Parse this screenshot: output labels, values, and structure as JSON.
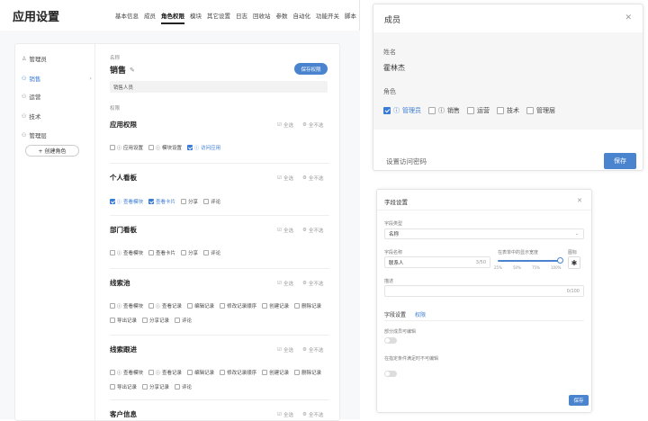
{
  "app": {
    "title": "应用设置",
    "tabs": [
      "基本信息",
      "成员",
      "角色权限",
      "模块",
      "其它设置",
      "日志",
      "回收站",
      "参数",
      "自动化",
      "功能开关",
      "脚本"
    ],
    "active_tab": "角色权限"
  },
  "sidebar": {
    "items": [
      {
        "label": "管理员",
        "icon": "user-icon"
      },
      {
        "label": "销售",
        "icon": "users-icon",
        "active": true
      },
      {
        "label": "运营",
        "icon": "users-icon"
      },
      {
        "label": "技术",
        "icon": "users-icon"
      },
      {
        "label": "管理层",
        "icon": "users-icon"
      }
    ],
    "create_label": "+ 创建角色"
  },
  "role": {
    "name_label": "名称",
    "name": "销售",
    "desc": "销售人员",
    "save_label": "保存权限",
    "perm_label": "权限"
  },
  "common": {
    "select_all": "全选",
    "select_none": "全不选"
  },
  "sections": [
    {
      "title": "应用权限",
      "options": [
        {
          "label": "应用设置",
          "info": true
        },
        {
          "label": "模块设置",
          "info": true
        },
        {
          "label": "访问应用",
          "info": true,
          "checked": true
        }
      ]
    },
    {
      "title": "个人看板",
      "options": [
        {
          "label": "查看模块",
          "info": true,
          "checked": true
        },
        {
          "label": "查看卡片",
          "checked": true
        },
        {
          "label": "分享"
        },
        {
          "label": "评论"
        }
      ]
    },
    {
      "title": "部门看板",
      "options": [
        {
          "label": "查看模块",
          "info": true
        },
        {
          "label": "查看卡片"
        },
        {
          "label": "分享"
        },
        {
          "label": "评论"
        }
      ]
    },
    {
      "title": "线索池",
      "options": [
        {
          "label": "查看模块",
          "info": true
        },
        {
          "label": "查看记录",
          "info": true
        },
        {
          "label": "编辑记录"
        },
        {
          "label": "修改记录顺序"
        },
        {
          "label": "创建记录"
        },
        {
          "label": "删除记录"
        },
        {
          "label": "导出记录"
        },
        {
          "label": "分享记录"
        },
        {
          "label": "评论"
        }
      ]
    },
    {
      "title": "线索跟进",
      "options": [
        {
          "label": "查看模块",
          "info": true
        },
        {
          "label": "查看记录",
          "info": true
        },
        {
          "label": "编辑记录"
        },
        {
          "label": "修改记录顺序"
        },
        {
          "label": "创建记录"
        },
        {
          "label": "删除记录"
        },
        {
          "label": "导出记录"
        },
        {
          "label": "分享记录"
        },
        {
          "label": "评论"
        }
      ]
    },
    {
      "title": "客户信息",
      "options": []
    }
  ],
  "member_dialog": {
    "title": "成员",
    "name_label": "姓名",
    "name": "霍林杰",
    "role_label": "角色",
    "roles": [
      {
        "label": "管理员",
        "info": true,
        "checked": true
      },
      {
        "label": "销售",
        "info": true
      },
      {
        "label": "运营"
      },
      {
        "label": "技术"
      },
      {
        "label": "管理层"
      }
    ],
    "pwd_label": "设置访问密码",
    "save_label": "保存"
  },
  "field_dialog": {
    "title": "字段设置",
    "type_label": "字段类型",
    "type_value": "名称",
    "name_label": "字段名称",
    "name_value": "联系人",
    "name_count": "3/50",
    "width_label": "在表单中的显示宽度",
    "width_ticks": [
      "25%",
      "50%",
      "75%",
      "100%"
    ],
    "width_value": 1.0,
    "icon_label": "图标",
    "desc_label": "描述",
    "desc_count": "0/100",
    "tabs": [
      "字段设置",
      "权限"
    ],
    "active_tab": "权限",
    "perm1_label": "部分成员可编辑",
    "perm2_label": "在指定条件满足时不可编辑",
    "save_label": "保存"
  }
}
